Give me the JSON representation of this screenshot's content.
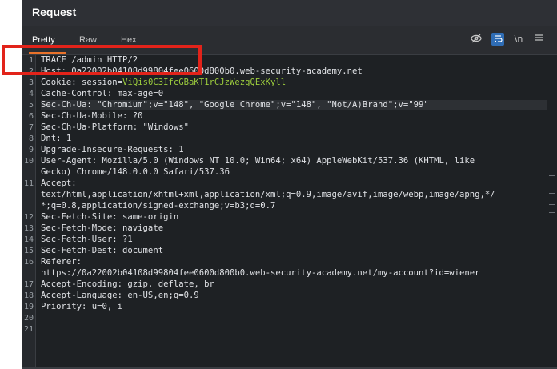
{
  "panel": {
    "title": "Request",
    "tabs": [
      "Pretty",
      "Raw",
      "Hex"
    ],
    "active_tab": "Pretty",
    "tools": {
      "eye_icon": "eye-slash-icon",
      "wrap_icon": "word-wrap-icon",
      "newline_label": "\\n",
      "menu_icon": "hamburger-menu-icon"
    }
  },
  "lines": [
    {
      "n": "1",
      "text": "TRACE /admin HTTP/2"
    },
    {
      "n": "2",
      "text": "Host: 0a22002b04108d99804fee0600d800b0.web-security-academy.net"
    },
    {
      "n": "3",
      "prefix": "Cookie: session=",
      "value": "ViQis0C3IfcGBaKT1rCJzWezgQExKyll"
    },
    {
      "n": "4",
      "text": "Cache-Control: max-age=0"
    },
    {
      "n": "5",
      "text": "Sec-Ch-Ua: \"Chromium\";v=\"148\", \"Google Chrome\";v=\"148\", \"Not/A)Brand\";v=\"99\""
    },
    {
      "n": "6",
      "text": "Sec-Ch-Ua-Mobile: ?0"
    },
    {
      "n": "7",
      "text": "Sec-Ch-Ua-Platform: \"Windows\""
    },
    {
      "n": "8",
      "text": "Dnt: 1"
    },
    {
      "n": "9",
      "text": "Upgrade-Insecure-Requests: 1"
    },
    {
      "n": "10",
      "text": "User-Agent: Mozilla/5.0 (Windows NT 10.0; Win64; x64) AppleWebKit/537.36 (KHTML, like"
    },
    {
      "n": "",
      "text": "Gecko) Chrome/148.0.0.0 Safari/537.36"
    },
    {
      "n": "11",
      "text": "Accept:"
    },
    {
      "n": "",
      "text": "text/html,application/xhtml+xml,application/xml;q=0.9,image/avif,image/webp,image/apng,*/"
    },
    {
      "n": "",
      "text": "*;q=0.8,application/signed-exchange;v=b3;q=0.7"
    },
    {
      "n": "12",
      "text": "Sec-Fetch-Site: same-origin"
    },
    {
      "n": "13",
      "text": "Sec-Fetch-Mode: navigate"
    },
    {
      "n": "14",
      "text": "Sec-Fetch-User: ?1"
    },
    {
      "n": "15",
      "text": "Sec-Fetch-Dest: document"
    },
    {
      "n": "16",
      "text": "Referer:"
    },
    {
      "n": "",
      "text": "https://0a22002b04108d99804fee0600d800b0.web-security-academy.net/my-account?id=wiener"
    },
    {
      "n": "17",
      "text": "Accept-Encoding: gzip, deflate, br"
    },
    {
      "n": "18",
      "text": "Accept-Language: en-US,en;q=0.9"
    },
    {
      "n": "19",
      "text": "Priority: u=0, i"
    },
    {
      "n": "20",
      "text": ""
    },
    {
      "n": "21",
      "text": ""
    }
  ],
  "colors": {
    "accent": "#e8722a",
    "cookie_value": "#9ccc3d",
    "annotation": "#e2231a"
  }
}
